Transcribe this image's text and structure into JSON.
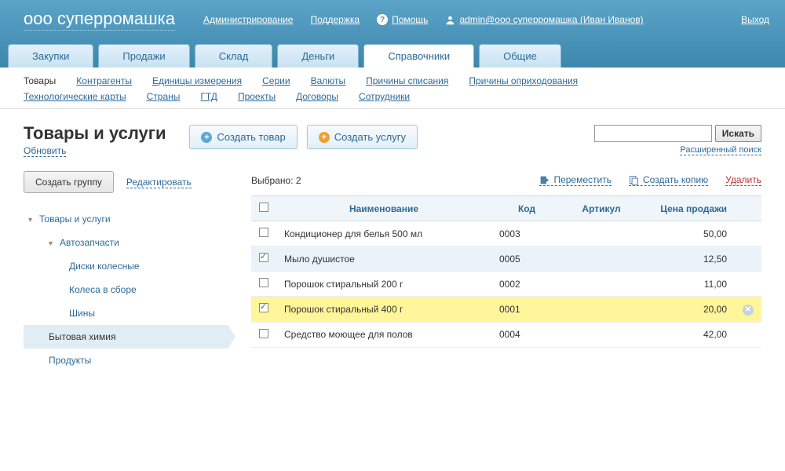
{
  "header": {
    "brand": "ооо суперромашка",
    "admin_link": "Администрирование",
    "support_link": "Поддержка",
    "help_link": "Помощь",
    "user_link": "admin@ооо суперромашка (Иван Иванов)",
    "logout_link": "Выход"
  },
  "tabs": [
    {
      "label": "Закупки",
      "active": false
    },
    {
      "label": "Продажи",
      "active": false
    },
    {
      "label": "Склад",
      "active": false
    },
    {
      "label": "Деньги",
      "active": false
    },
    {
      "label": "Справочники",
      "active": true
    },
    {
      "label": "Общие",
      "active": false
    }
  ],
  "subnav": {
    "row1": [
      "Товары",
      "Контрагенты",
      "Единицы измерения",
      "Серии",
      "Валюты",
      "Причины списания",
      "Причины оприходования"
    ],
    "row2": [
      "Технологические карты",
      "Страны",
      "ГТД",
      "Проекты",
      "Договоры",
      "Сотрудники"
    ],
    "current": "Товары"
  },
  "page": {
    "title": "Товары и услуги",
    "refresh": "Обновить",
    "create_good": "Создать товар",
    "create_service": "Создать услугу"
  },
  "search": {
    "button": "Искать",
    "advanced": "Расширенный поиск"
  },
  "sidebar": {
    "create_group": "Создать группу",
    "edit": "Редактировать",
    "tree": [
      {
        "label": "Товары и услуги",
        "level": 1,
        "expanded": true
      },
      {
        "label": "Автозапчасти",
        "level": 2,
        "expanded": true
      },
      {
        "label": "Диски колесные",
        "level": 3
      },
      {
        "label": "Колеса в сборе",
        "level": 3
      },
      {
        "label": "Шины",
        "level": 3
      },
      {
        "label": "Бытовая химия",
        "level": 2,
        "selected": true
      },
      {
        "label": "Продукты",
        "level": 2
      }
    ]
  },
  "toolbar": {
    "selected_label": "Выбрано: 2",
    "move": "Переместить",
    "copy": "Создать копию",
    "delete": "Удалить"
  },
  "table": {
    "columns": {
      "name": "Наименование",
      "code": "Код",
      "sku": "Артикул",
      "price": "Цена продажи"
    },
    "rows": [
      {
        "checked": false,
        "name": "Кондиционер для белья 500 мл",
        "code": "0003",
        "sku": "",
        "price": "50,00",
        "state": ""
      },
      {
        "checked": true,
        "name": "Мыло душистое",
        "code": "0005",
        "sku": "",
        "price": "12,50",
        "state": "sel"
      },
      {
        "checked": false,
        "name": "Порошок стиральный 200 г",
        "code": "0002",
        "sku": "",
        "price": "11,00",
        "state": ""
      },
      {
        "checked": true,
        "name": "Порошок стиральный 400 г",
        "code": "0001",
        "sku": "",
        "price": "20,00",
        "state": "hl",
        "deletable": true
      },
      {
        "checked": false,
        "name": "Средство моющее для полов",
        "code": "0004",
        "sku": "",
        "price": "42,00",
        "state": ""
      }
    ]
  }
}
